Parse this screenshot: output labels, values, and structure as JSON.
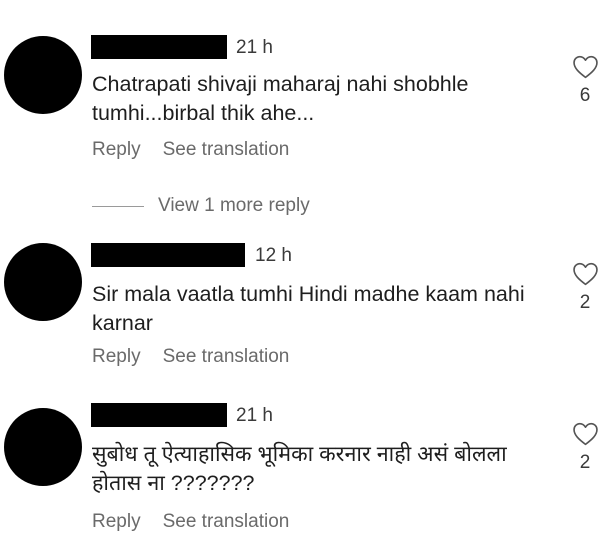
{
  "comments": [
    {
      "time": "21 h",
      "text": "Chatrapati shivaji maharaj nahi shobhle tumhi...birbal thik ahe...",
      "likes": "6",
      "reply_label": "Reply",
      "translate_label": "See translation"
    },
    {
      "time": "12 h",
      "text": "Sir mala vaatla tumhi Hindi madhe kaam nahi karnar",
      "likes": "2",
      "reply_label": "Reply",
      "translate_label": "See translation"
    },
    {
      "time": "21 h",
      "text": "सुबोध तू ऐत्याहासिक भूमिका करनार नाही असं बोलला होतास ना ???????",
      "likes": "2",
      "reply_label": "Reply",
      "translate_label": "See translation"
    }
  ],
  "view_more_label": "View 1 more reply",
  "icons": {
    "avatar": "avatar-redacted",
    "like": "heart-outline-icon"
  },
  "colors": {
    "text": "#1e1e1e",
    "secondary": "#6a6a6a",
    "redaction": "#000000"
  }
}
